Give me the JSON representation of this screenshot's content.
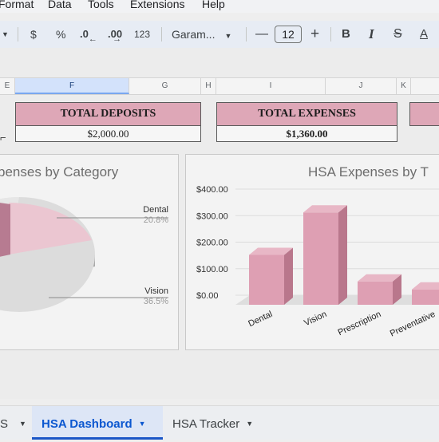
{
  "menubar": {
    "items": [
      "Format",
      "Data",
      "Tools",
      "Extensions",
      "Help"
    ]
  },
  "toolbar": {
    "currency": "$",
    "percent": "%",
    "decrease_decimal": ".0",
    "increase_decimal": ".00",
    "number_format": "123",
    "font": "Garam...",
    "font_size": "12",
    "minus": "—",
    "plus": "+",
    "bold": "B",
    "italic": "I",
    "text_color": "A"
  },
  "columns": [
    "E",
    "F",
    "G",
    "H",
    "I",
    "J",
    "K"
  ],
  "summary": [
    {
      "label": "TOTAL DEPOSITS",
      "value": "$2,000.00"
    },
    {
      "label": "TOTAL EXPENSES",
      "value": "$1,360.00"
    }
  ],
  "pie_chart": {
    "title": "HSA Expenses by Category",
    "visible_title": "penses by Category",
    "slices": [
      {
        "name": "Dental",
        "pct": "20.8%"
      },
      {
        "name": "Vision",
        "pct": "36.5%"
      }
    ]
  },
  "chart_data": {
    "type": "bar",
    "title": "HSA Expenses by T",
    "categories": [
      "Dental",
      "Vision",
      "Prescription",
      "Preventative"
    ],
    "values": [
      170,
      330,
      70,
      40
    ],
    "yticks": [
      "$0.00",
      "$100.00",
      "$200.00",
      "$300.00",
      "$400.00"
    ],
    "ylim": [
      0,
      400
    ],
    "color": "#de9fb3"
  },
  "sheet_tabs": {
    "partial": "S",
    "active": "HSA Dashboard",
    "other": "HSA Tracker"
  }
}
